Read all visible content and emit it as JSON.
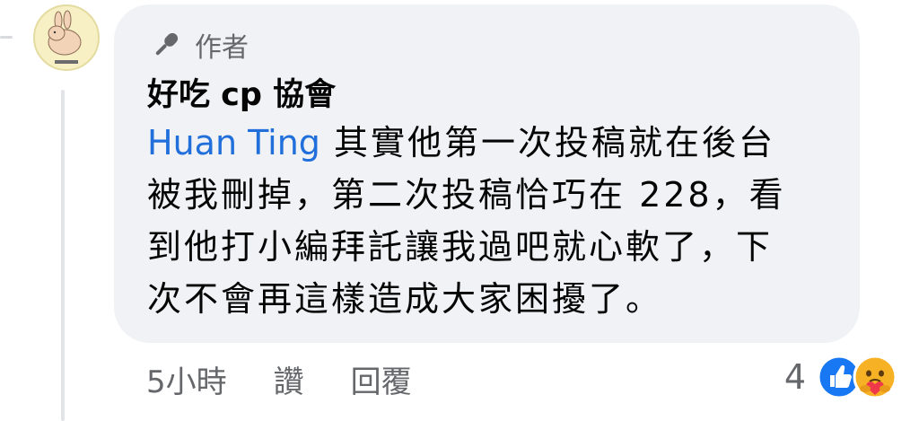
{
  "comment": {
    "badge_label": "作者",
    "author_name": "好吃 cp 協會",
    "mention": "Huan Ting",
    "body_lines": [
      " 其實他第一次投稿就在後台",
      "被我刪掉，第二次投稿恰巧在 228，看",
      "到他打小編拜託讓我過吧就心軟了，下",
      "次不會再這樣造成大家困擾了。"
    ],
    "timestamp": "5小時",
    "like_label": "讚",
    "reply_label": "回覆",
    "reaction_count": "4",
    "reaction_icons": [
      "like-icon",
      "care-icon"
    ],
    "accent_color": "#216fdb",
    "badge_icon": "microphone-icon"
  }
}
